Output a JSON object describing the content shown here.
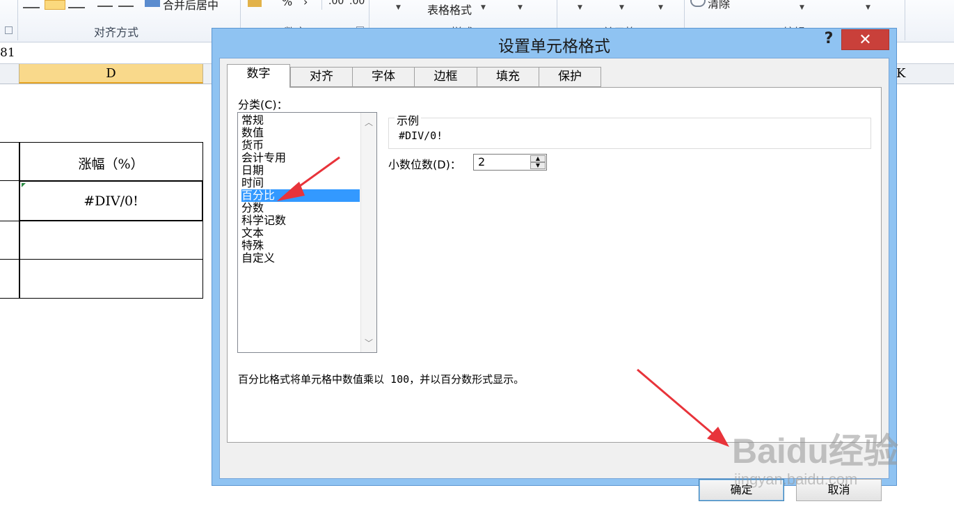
{
  "ribbon": {
    "merge_label": "合并后居中",
    "percent_symbol": "%",
    "comma_symbol": "›",
    "decimal_inc": ".00",
    "decimal_dec": ".00",
    "table_format": "表格格式",
    "clear_label": "清除",
    "group_alignment": "对齐方式",
    "group_number": "数字",
    "group_styles": "样式",
    "group_cells": "单元格",
    "group_editing": "编辑"
  },
  "formula_bar": {
    "value": "81"
  },
  "headers": {
    "col_d": "D",
    "col_k": "K"
  },
  "sheet": {
    "header_cell": "涨幅（%）",
    "value_cell": "#DIV/0!"
  },
  "dialog": {
    "title": "设置单元格格式",
    "help": "?",
    "close": "✕",
    "tabs": [
      "数字",
      "对齐",
      "字体",
      "边框",
      "填充",
      "保护"
    ],
    "category_label": "分类(C)：",
    "categories": [
      "常规",
      "数值",
      "货币",
      "会计专用",
      "日期",
      "时间",
      "百分比",
      "分数",
      "科学记数",
      "文本",
      "特殊",
      "自定义"
    ],
    "selected_category": "百分比",
    "sample_label": "示例",
    "sample_value": "#DIV/0!",
    "decimals_label": "小数位数(D)：",
    "decimals_value": "2",
    "description": "百分比格式将单元格中数值乘以 100，并以百分数形式显示。",
    "ok": "确定",
    "cancel": "取消"
  },
  "watermark": {
    "brand": "Baidu经验",
    "url": "jingyan.baidu.com"
  },
  "colors": {
    "selection": "#3399ff",
    "close_button": "#c9403a",
    "dialog_frame": "#8fc3f2",
    "arrow": "#e8333a"
  }
}
